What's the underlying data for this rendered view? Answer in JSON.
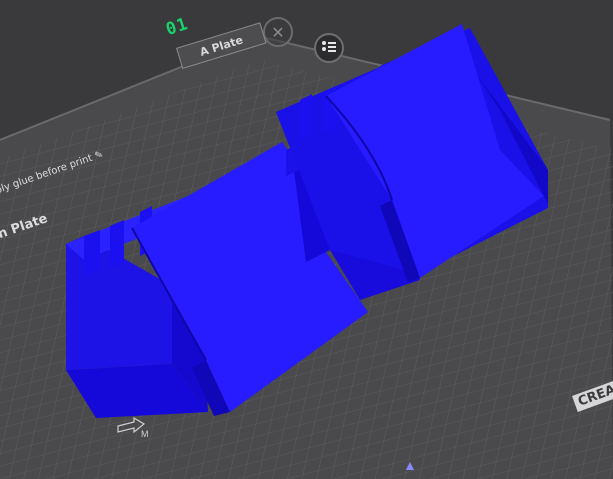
{
  "plate": {
    "number": "01",
    "tab_label": "A Plate",
    "name": "n Plate",
    "note": "ply glue before print",
    "edit_icon": "pencil-icon"
  },
  "toolbar": {
    "close_icon": "close-icon",
    "arrange_icon": "arrange-icon"
  },
  "bed": {
    "brand_label": "CREA",
    "grid_color": "#5a5a5c",
    "bed_color": "#4a4a4c",
    "model_color": "#1a10f0"
  }
}
